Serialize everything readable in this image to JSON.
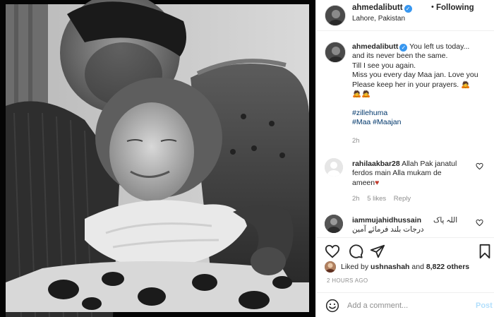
{
  "post": {
    "username": "ahmedalibutt",
    "dot": "•",
    "follow_label": "Following",
    "location": "Lahore, Pakistan",
    "photo_alt": "Black and white photo of a man kissing an elderly woman's forehead"
  },
  "caption": {
    "username": "ahmedalibutt",
    "lines": [
      "You left us today...",
      "and its never been the same.",
      "Till I see you again.",
      "Miss you every day Maa jan. Love you",
      "Please keep her in your prayers. 🙇"
    ],
    "emoji_line": "🙇🙇",
    "hashtags_line1": "#zillehuma",
    "hashtags_line2": "#Maa #Maajan",
    "time": "2h"
  },
  "comments": [
    {
      "username": "rahilaakbar28",
      "text_line1": "Allah Pak janatul",
      "text_line2": "ferdos main Alla mukam de",
      "text_line3": "ameen",
      "emoji": "♥",
      "time": "2h",
      "likes": "5 likes",
      "reply": "Reply",
      "heart_icon": "heart-outline-icon"
    },
    {
      "username": "iammujahidhussain",
      "text_line1": "اللہ پاک",
      "text_line2": "درجات بلند فرمائے آمین",
      "heart_icon": "heart-outline-icon"
    }
  ],
  "actions": {
    "icons": [
      "heart-icon",
      "comment-icon",
      "share-icon",
      "bookmark-icon"
    ]
  },
  "likes": {
    "prefix": "Liked by",
    "user": "ushnashah",
    "and": "and",
    "others": "8,822 others"
  },
  "posted_time": "2 HOURS AGO",
  "add_comment": {
    "placeholder": "Add a comment...",
    "post_label": "Post"
  },
  "colors": {
    "link": "#00376b",
    "muted": "#8e8e8e",
    "post_disabled": "#b2dffc",
    "verified": "#3897f0"
  }
}
